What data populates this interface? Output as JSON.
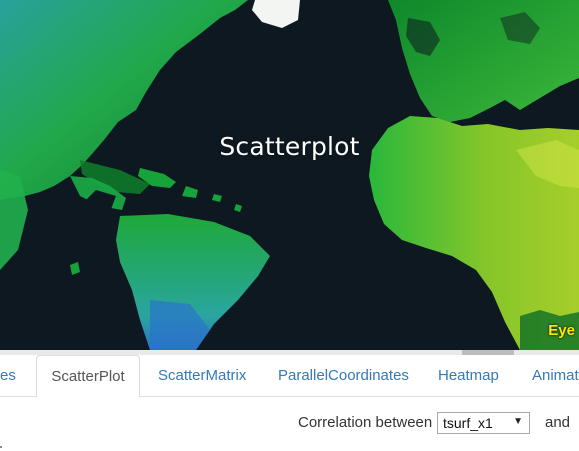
{
  "map": {
    "overlay_title": "Scatterplot",
    "badge_text": "Eye",
    "colors": {
      "ocean": "#0d1820",
      "land_green": "#18a52d",
      "land_yellow": "#a9d22a",
      "land_cyan": "#2aa8a2",
      "ice": "#f2f5f2",
      "badge_text": "#ffea00"
    }
  },
  "tabs": {
    "items": [
      {
        "label": "es",
        "active": false
      },
      {
        "label": "ScatterPlot",
        "active": true
      },
      {
        "label": "ScatterMatrix",
        "active": false
      },
      {
        "label": "ParallelCoordinates",
        "active": false
      },
      {
        "label": "Heatmap",
        "active": false
      },
      {
        "label": "Animati",
        "active": false
      }
    ]
  },
  "controls": {
    "correlation_label": "Correlation between",
    "selected_variable": "tsurf_x1",
    "and_label": "and"
  }
}
